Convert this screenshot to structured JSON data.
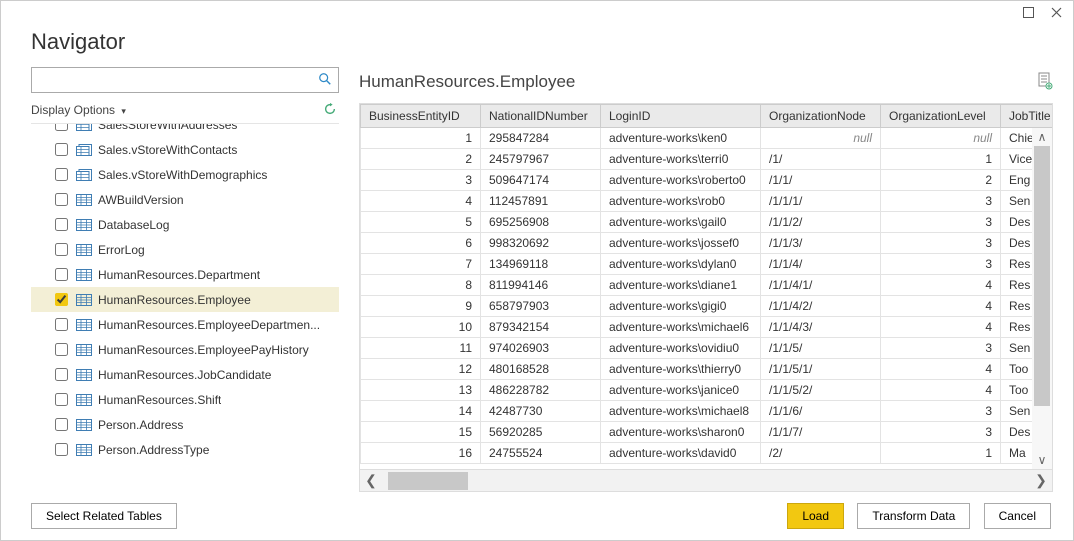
{
  "window": {
    "title": "Navigator"
  },
  "search": {
    "placeholder": ""
  },
  "display_options_label": "Display Options",
  "tree": {
    "items": [
      {
        "label": "SalesStoreWithAddresses",
        "icon": "view",
        "checked": false,
        "partial": true
      },
      {
        "label": "Sales.vStoreWithContacts",
        "icon": "view",
        "checked": false
      },
      {
        "label": "Sales.vStoreWithDemographics",
        "icon": "view",
        "checked": false
      },
      {
        "label": "AWBuildVersion",
        "icon": "table",
        "checked": false
      },
      {
        "label": "DatabaseLog",
        "icon": "table",
        "checked": false
      },
      {
        "label": "ErrorLog",
        "icon": "table",
        "checked": false
      },
      {
        "label": "HumanResources.Department",
        "icon": "table",
        "checked": false
      },
      {
        "label": "HumanResources.Employee",
        "icon": "table",
        "checked": true,
        "selected": true
      },
      {
        "label": "HumanResources.EmployeeDepartmen...",
        "icon": "table",
        "checked": false
      },
      {
        "label": "HumanResources.EmployeePayHistory",
        "icon": "table",
        "checked": false
      },
      {
        "label": "HumanResources.JobCandidate",
        "icon": "table",
        "checked": false
      },
      {
        "label": "HumanResources.Shift",
        "icon": "table",
        "checked": false
      },
      {
        "label": "Person.Address",
        "icon": "table",
        "checked": false
      },
      {
        "label": "Person.AddressType",
        "icon": "table",
        "checked": false
      }
    ]
  },
  "preview": {
    "title": "HumanResources.Employee",
    "columns": [
      "BusinessEntityID",
      "NationalIDNumber",
      "LoginID",
      "OrganizationNode",
      "OrganizationLevel",
      "JobTitle"
    ],
    "rows": [
      {
        "id": 1,
        "nid": "295847284",
        "login": "adventure-works\\ken0",
        "node": null,
        "lvl": null,
        "job": "Chief"
      },
      {
        "id": 2,
        "nid": "245797967",
        "login": "adventure-works\\terri0",
        "node": "/1/",
        "lvl": 1,
        "job": "Vice"
      },
      {
        "id": 3,
        "nid": "509647174",
        "login": "adventure-works\\roberto0",
        "node": "/1/1/",
        "lvl": 2,
        "job": "Eng"
      },
      {
        "id": 4,
        "nid": "112457891",
        "login": "adventure-works\\rob0",
        "node": "/1/1/1/",
        "lvl": 3,
        "job": "Sen"
      },
      {
        "id": 5,
        "nid": "695256908",
        "login": "adventure-works\\gail0",
        "node": "/1/1/2/",
        "lvl": 3,
        "job": "Des"
      },
      {
        "id": 6,
        "nid": "998320692",
        "login": "adventure-works\\jossef0",
        "node": "/1/1/3/",
        "lvl": 3,
        "job": "Des"
      },
      {
        "id": 7,
        "nid": "134969118",
        "login": "adventure-works\\dylan0",
        "node": "/1/1/4/",
        "lvl": 3,
        "job": "Res"
      },
      {
        "id": 8,
        "nid": "811994146",
        "login": "adventure-works\\diane1",
        "node": "/1/1/4/1/",
        "lvl": 4,
        "job": "Res"
      },
      {
        "id": 9,
        "nid": "658797903",
        "login": "adventure-works\\gigi0",
        "node": "/1/1/4/2/",
        "lvl": 4,
        "job": "Res"
      },
      {
        "id": 10,
        "nid": "879342154",
        "login": "adventure-works\\michael6",
        "node": "/1/1/4/3/",
        "lvl": 4,
        "job": "Res"
      },
      {
        "id": 11,
        "nid": "974026903",
        "login": "adventure-works\\ovidiu0",
        "node": "/1/1/5/",
        "lvl": 3,
        "job": "Sen"
      },
      {
        "id": 12,
        "nid": "480168528",
        "login": "adventure-works\\thierry0",
        "node": "/1/1/5/1/",
        "lvl": 4,
        "job": "Too"
      },
      {
        "id": 13,
        "nid": "486228782",
        "login": "adventure-works\\janice0",
        "node": "/1/1/5/2/",
        "lvl": 4,
        "job": "Too"
      },
      {
        "id": 14,
        "nid": "42487730",
        "login": "adventure-works\\michael8",
        "node": "/1/1/6/",
        "lvl": 3,
        "job": "Sen"
      },
      {
        "id": 15,
        "nid": "56920285",
        "login": "adventure-works\\sharon0",
        "node": "/1/1/7/",
        "lvl": 3,
        "job": "Des"
      },
      {
        "id": 16,
        "nid": "24755524",
        "login": "adventure-works\\david0",
        "node": "/2/",
        "lvl": 1,
        "job": "Ma"
      }
    ]
  },
  "buttons": {
    "select_related": "Select Related Tables",
    "load": "Load",
    "transform": "Transform Data",
    "cancel": "Cancel"
  },
  "colors": {
    "accent": "#f2c811"
  },
  "null_text": "null"
}
